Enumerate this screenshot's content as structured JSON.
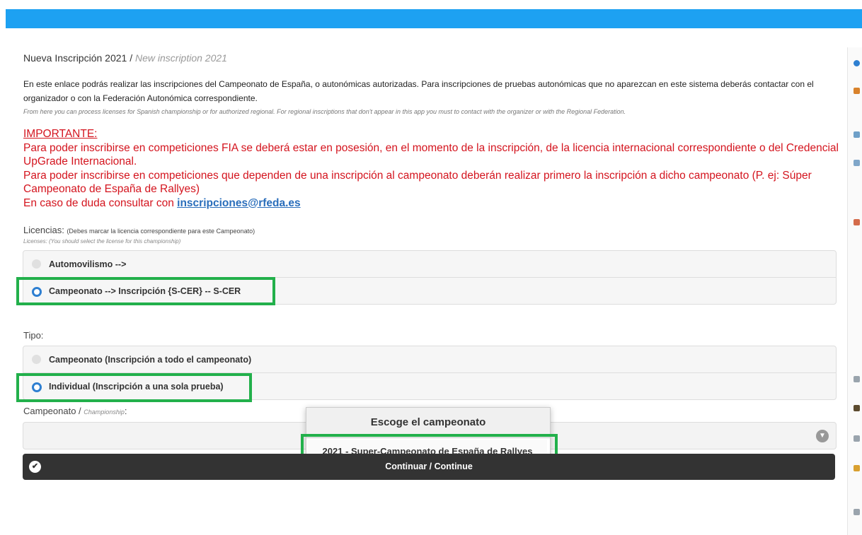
{
  "header": {
    "title_es": "Nueva Inscripción 2021",
    "separator": "/",
    "title_en": "New inscription 2021"
  },
  "intro": {
    "es": "En este enlace podrás realizar las inscripciones del Campeonato de España, o autonómicas autorizadas. Para inscripciones de pruebas autonómicas que no aparezcan en este sistema deberás contactar con el organizador o con la Federación Autonómica correspondiente.",
    "en": "From here you can process licenses for Spanish championship or for authorized regional. For regional inscriptions that don't appear in this app you must to contact with the organizer or with the Regional Federation."
  },
  "important": {
    "title": "IMPORTANTE:",
    "line1": "Para poder inscribirse en competiciones FIA se deberá estar en posesión, en el momento de la inscripción, de la licencia internacional correspondiente o del Credencial UpGrade Internacional.",
    "line2": "Para poder inscribirse en competiciones que dependen de una inscripción al campeonato deberán realizar primero la inscripción a dicho campeonato (P. ej: Súper Campeonato de España de Rallyes)",
    "line3_prefix": "En caso de duda consultar con",
    "email": "inscripciones@rfeda.es"
  },
  "licencias": {
    "label": "Licencias:",
    "hint": "(Debes marcar la licencia correspondiente para este Campeonato)",
    "hint_en": "Licenses: (You should select the license for this championship)",
    "options": [
      "Automovilismo -->",
      "Campeonato --> Inscripción {S-CER} -- S-CER"
    ],
    "selected": "Campeonato --> Inscripción {S-CER} -- S-CER"
  },
  "tipo": {
    "label": "Tipo:",
    "options": [
      "Campeonato (Inscripción a todo el campeonato)",
      "Individual (Inscripción a una sola prueba)"
    ],
    "selected": "Individual (Inscripción a una sola prueba)"
  },
  "campeonato": {
    "label": "Campeonato /",
    "label_en": "Championship",
    "colon": ":",
    "popup_title": "Escoge el campeonato",
    "popup_option": "2021 - Super-Campeonato de España de Rallyes"
  },
  "continue_label": "Continuar / Continue",
  "colors": {
    "topbar": "#1da1f2",
    "important_text": "#d4141e",
    "highlight_box": "#22b04b",
    "radio_selected": "#2e7fd1",
    "continue_bg": "#333333"
  }
}
